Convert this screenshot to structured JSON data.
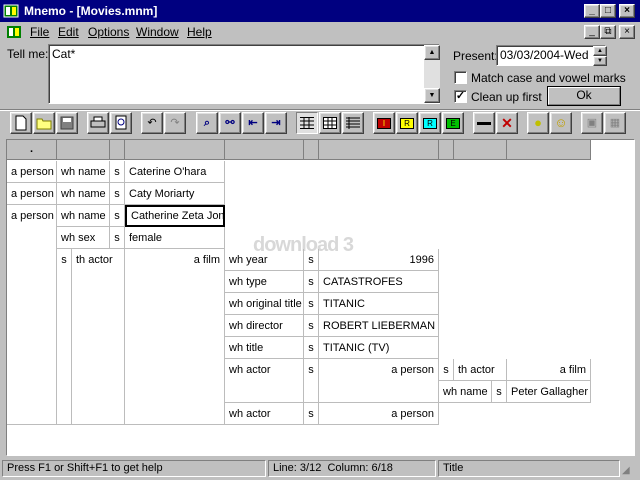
{
  "window": {
    "title": "Mnemo - [Movies.mnm]",
    "app_icon": "book-icon"
  },
  "menu": {
    "items": [
      "File",
      "Edit",
      "Options",
      "Window",
      "Help"
    ]
  },
  "query": {
    "label": "Tell me:",
    "value": "Cat*"
  },
  "options": {
    "present_label": "Present:",
    "present_value": "03/03/2004-Wed",
    "match_case_label": "Match case and vowel marks",
    "match_case_checked": false,
    "clean_up_label": "Clean up first",
    "clean_up_checked": true,
    "ok_label": "Ok"
  },
  "toolbar": {
    "buttons": [
      "new-icon",
      "open-icon",
      "save-icon",
      "print-icon",
      "print-preview-icon",
      "undo-icon",
      "redo-icon",
      "find-icon",
      "find-next-icon",
      "find-first-icon",
      "find-last-icon",
      "grid-view-icon",
      "table-view-icon",
      "list-view-icon",
      "tag-red-icon",
      "tag-yellow-icon",
      "tag-cyan-icon",
      "tag-green-icon",
      "line-icon",
      "delete-icon",
      "bulb-icon",
      "smile-icon",
      "image-icon",
      "sheet-icon"
    ],
    "tag_labels": [
      "I",
      "R",
      "R",
      "E"
    ]
  },
  "grid": {
    "header_first": ".",
    "watermark": "download 3",
    "rows": [
      [
        "a person",
        "wh name",
        "s",
        "Caterine O'hara"
      ],
      [
        "a person",
        "wh name",
        "s",
        "Caty Moriarty"
      ],
      [
        "a person",
        "wh name",
        "s",
        "Catherine Zeta Jon"
      ],
      [
        "",
        "wh sex",
        "s",
        "female"
      ]
    ],
    "actor_row": {
      "s": "s",
      "rel": "th actor",
      "obj": "a film"
    },
    "film_props": [
      [
        "wh year",
        "s",
        "1996"
      ],
      [
        "wh type",
        "s",
        "CATASTROFES"
      ],
      [
        "wh original title",
        "s",
        "TITANIC"
      ],
      [
        "wh director",
        "s",
        "ROBERT LIEBERMAN"
      ],
      [
        "wh title",
        "s",
        "TITANIC (TV)"
      ]
    ],
    "nested": {
      "rel": "wh actor",
      "s": "s",
      "obj": "a person",
      "s2": "s",
      "rel2": "th actor",
      "obj2": "a film",
      "name_rel": "wh name",
      "name_s": "s",
      "name_val": "Peter Gallagher"
    },
    "last": {
      "rel": "wh actor",
      "s": "s",
      "obj": "a person"
    }
  },
  "status": {
    "help": "Press F1 or Shift+F1 to get help",
    "line": "Line: 3/12",
    "column": "Column: 6/18",
    "field": "Title"
  }
}
